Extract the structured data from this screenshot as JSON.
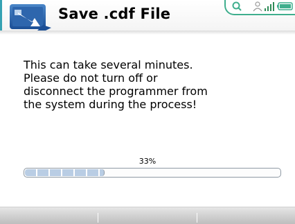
{
  "window": {
    "title": "Save .cdf File"
  },
  "header": {
    "icon": "save-to-device-icon",
    "status_icons": [
      "search-icon",
      "user-icon",
      "signal-icon",
      "battery-icon"
    ]
  },
  "message": {
    "text": "This can take several minutes.\nPlease do not turn off or\ndisconnect the programmer from\nthe system during the process!"
  },
  "progress": {
    "percent_label": "33%",
    "value": 0.31
  },
  "softkeys": [
    {
      "label": ""
    },
    {
      "label": ""
    },
    {
      "label": ""
    }
  ],
  "colors": {
    "accent": "#35a2b3",
    "status_green": "#3fae8d",
    "progress_fill": "#b9cde4"
  }
}
